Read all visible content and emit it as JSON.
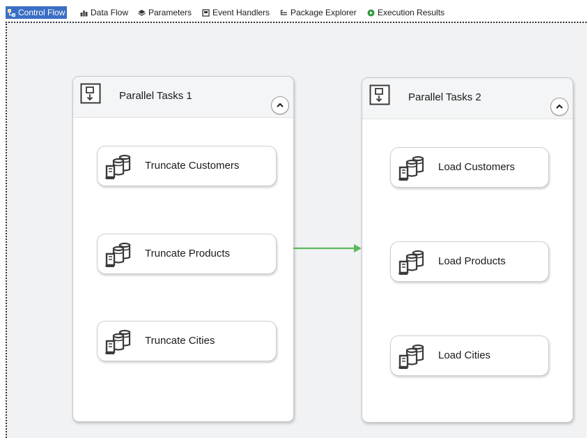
{
  "tabs": [
    {
      "label": "Control Flow",
      "icon": "control-flow-icon",
      "active": true
    },
    {
      "label": "Data Flow",
      "icon": "data-flow-icon",
      "active": false
    },
    {
      "label": "Parameters",
      "icon": "parameters-icon",
      "active": false
    },
    {
      "label": "Event Handlers",
      "icon": "event-handlers-icon",
      "active": false
    },
    {
      "label": "Package Explorer",
      "icon": "package-explorer-icon",
      "active": false
    },
    {
      "label": "Execution Results",
      "icon": "execution-results-icon",
      "active": false
    }
  ],
  "containers": [
    {
      "title": "Parallel Tasks 1",
      "icon": "sequence-container-icon",
      "tasks": [
        {
          "label": "Truncate Customers",
          "icon": "execute-sql-task-icon"
        },
        {
          "label": "Truncate Products",
          "icon": "execute-sql-task-icon"
        },
        {
          "label": "Truncate Cities",
          "icon": "execute-sql-task-icon"
        }
      ]
    },
    {
      "title": "Parallel Tasks 2",
      "icon": "sequence-container-icon",
      "tasks": [
        {
          "label": "Load Customers",
          "icon": "execute-sql-task-icon"
        },
        {
          "label": "Load Products",
          "icon": "execute-sql-task-icon"
        },
        {
          "label": "Load Cities",
          "icon": "execute-sql-task-icon"
        }
      ]
    }
  ],
  "colors": {
    "active_tab": "#3a6fc4",
    "precedence_constraint_success": "#5cb85c",
    "canvas_background": "#f1f2f4"
  }
}
